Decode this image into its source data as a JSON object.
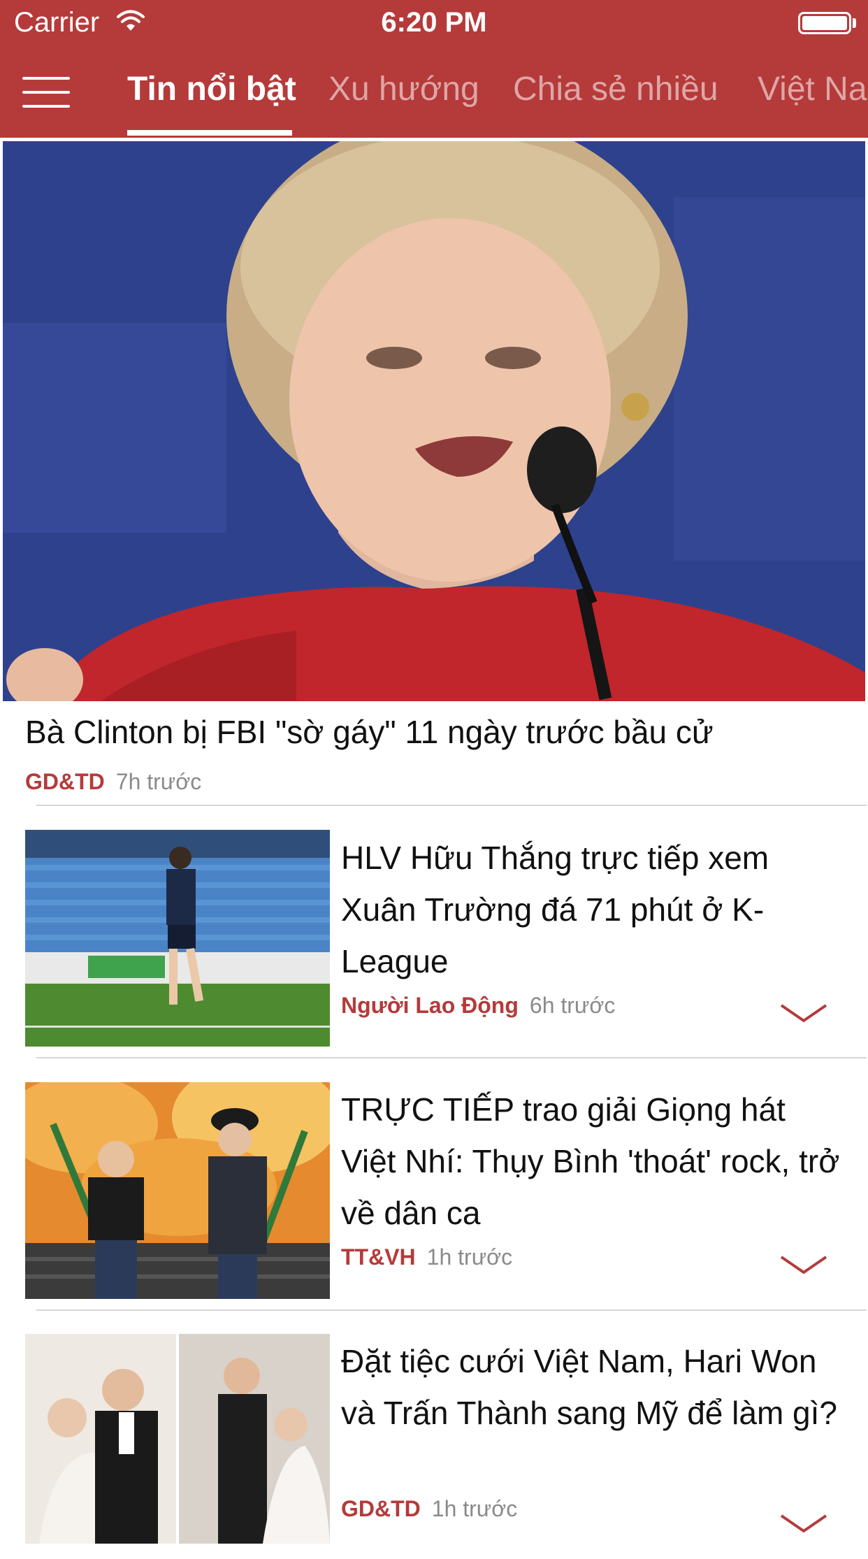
{
  "status_bar": {
    "carrier": "Carrier",
    "time": "6:20 PM"
  },
  "nav": {
    "menu_icon": "hamburger-menu-icon",
    "tabs": [
      {
        "label": "Tin nổi bật",
        "active": true
      },
      {
        "label": "Xu hướng",
        "active": false
      },
      {
        "label": "Chia sẻ nhiều",
        "active": false
      },
      {
        "label": "Việt Nam",
        "active": false
      }
    ]
  },
  "hero": {
    "title": "Bà Clinton bị FBI \"sờ gáy\" 11 ngày trước bầu cử",
    "source": "GD&TD",
    "time": "7h trước"
  },
  "articles": [
    {
      "title": "HLV Hữu Thắng trực tiếp xem Xuân Trường đá 71 phút ở K-League",
      "source": "Người Lao Động",
      "time": "6h trước"
    },
    {
      "title": "TRỰC TIẾP trao giải Giọng hát Việt Nhí: Thụy Bình 'thoát' rock, trở về dân ca",
      "source": "TT&VH",
      "time": "1h trước"
    },
    {
      "title": "Đặt tiệc cưới Việt Nam, Hari Won và Trấn Thành sang Mỹ để làm gì?",
      "source": "GD&TD",
      "time": "1h trước"
    }
  ],
  "colors": {
    "brand": "#b53a3a",
    "source_text": "#b53a3a",
    "meta_text": "#8a8a8a"
  }
}
